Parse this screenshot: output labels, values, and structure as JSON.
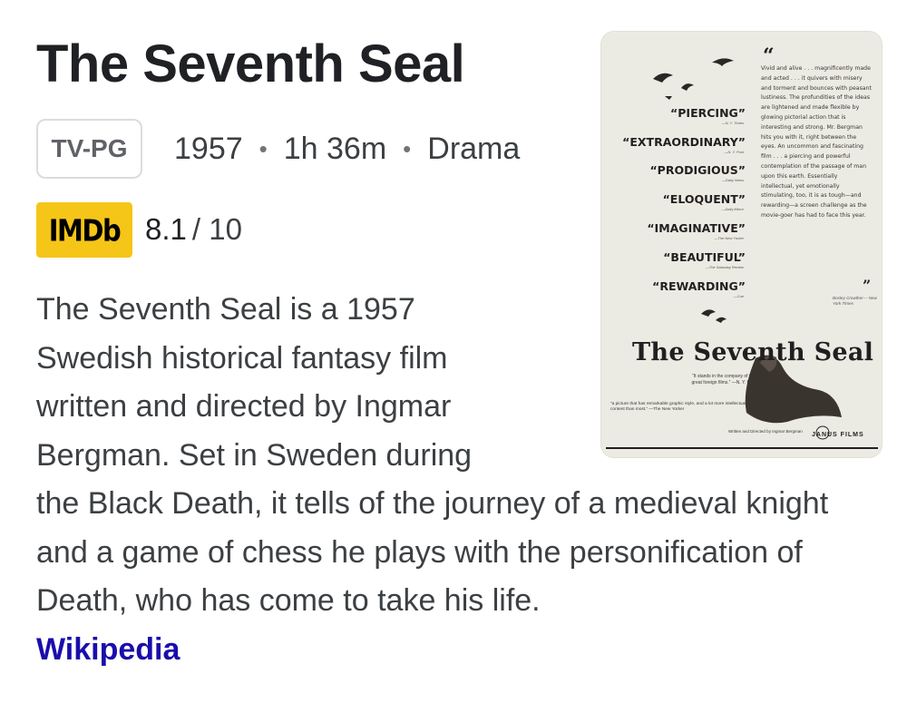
{
  "title": "The Seventh Seal",
  "rating": "TV-PG",
  "meta": {
    "year": "1957",
    "runtime": "1h 36m",
    "genre": "Drama",
    "separator": "•"
  },
  "imdb": {
    "logo_text": "IMDb",
    "score": "8.1",
    "max": "/ 10",
    "brand_color": "#f5c518"
  },
  "description": "The Seventh Seal is a 1957 Swedish historical fantasy film written and directed by Ingmar Bergman. Set in Sweden during the Black Death, it tells of the journey of a medieval knight and a game of chess he plays with the personification of Death, who has come to take his life.",
  "source_link": "Wikipedia",
  "poster": {
    "quotes": [
      {
        "word": "“PIERCING”",
        "source": "—N. Y. Times"
      },
      {
        "word": "“EXTRAORDINARY”",
        "source": "—N. Y. Post"
      },
      {
        "word": "“PRODIGIOUS”",
        "source": "—Daily News"
      },
      {
        "word": "“ELOQUENT”",
        "source": "—Daily Mirror"
      },
      {
        "word": "“IMAGINATIVE”",
        "source": "—The New Yorker"
      },
      {
        "word": "“BEAUTIFUL”",
        "source": "—The Saturday Review"
      },
      {
        "word": "“REWARDING”",
        "source": "—Cue"
      }
    ],
    "review": "Vivid and alive . . . magnificently made and acted . . . it quivers with misery and torment and bounces with peasant lustiness. The profundities of the ideas are lightened and made flexible by glowing pictorial action that is interesting and strong. Mr. Bergman hits you with it, right between the eyes. An uncommon and fascinating film . . . a piercing and powerful contemplation of the passage of man upon this earth. Essentially intellectual, yet emotionally stimulating, too, it is as tough—and rewarding—a screen challenge as the movie-goer has had to face this year.",
    "review_source": "Bosley Crowther— New York Times",
    "title": "The Seventh Seal",
    "tagline": "“It stands in the company of the great foreign films.” —N. Y. Post",
    "quote2": "“a picture that has remarkable graphic style, and a lot more intellectual content than most.” —The New Yorker",
    "credit": "Written and Directed by Ingmar Bergman",
    "distributor": "JANUS FILMS"
  }
}
